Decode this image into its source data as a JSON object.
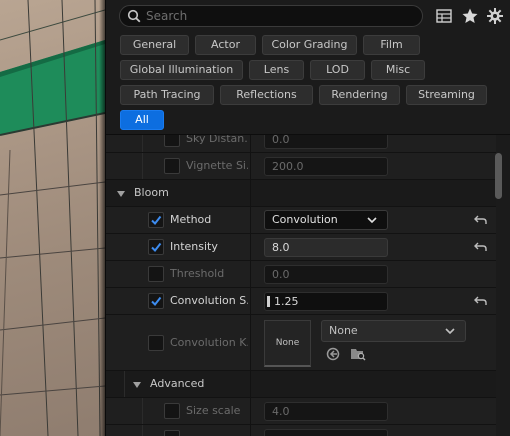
{
  "search": {
    "placeholder": "Search"
  },
  "toolbar": {
    "icons": [
      "table-view-icon",
      "favorites-star-icon",
      "settings-gear-icon"
    ]
  },
  "filters": [
    {
      "label": "General"
    },
    {
      "label": "Actor"
    },
    {
      "label": "Color Grading"
    },
    {
      "label": "Film"
    },
    {
      "label": "Global Illumination"
    },
    {
      "label": "Lens"
    },
    {
      "label": "LOD"
    },
    {
      "label": "Misc"
    },
    {
      "label": "Path Tracing"
    },
    {
      "label": "Reflections"
    },
    {
      "label": "Rendering"
    },
    {
      "label": "Streaming"
    },
    {
      "label": "All",
      "active": true
    }
  ],
  "properties": {
    "sky_distance": {
      "label": "Sky Distan...",
      "value": "0.0",
      "enabled": false
    },
    "vignette": {
      "label": "Vignette Si...",
      "value": "200.0",
      "enabled": false
    },
    "bloom": {
      "category": "Bloom",
      "method": {
        "label": "Method",
        "value": "Convolution",
        "enabled": true
      },
      "intensity": {
        "label": "Intensity",
        "value": "8.0",
        "enabled": true
      },
      "threshold": {
        "label": "Threshold",
        "value": "0.0",
        "enabled": false
      },
      "convolution_scale": {
        "label": "Convolution S...",
        "value": "1.25",
        "enabled": true
      },
      "convolution_kernel": {
        "label": "Convolution K...",
        "thumb": "None",
        "asset": "None",
        "enabled": false
      }
    },
    "advanced": {
      "category": "Advanced",
      "size_scale": {
        "label": "Size scale",
        "value": "4.0",
        "enabled": false
      }
    }
  },
  "colors": {
    "accent": "#0d6ee0",
    "panel": "#1b1b1b",
    "row": "#1f1f1f"
  }
}
